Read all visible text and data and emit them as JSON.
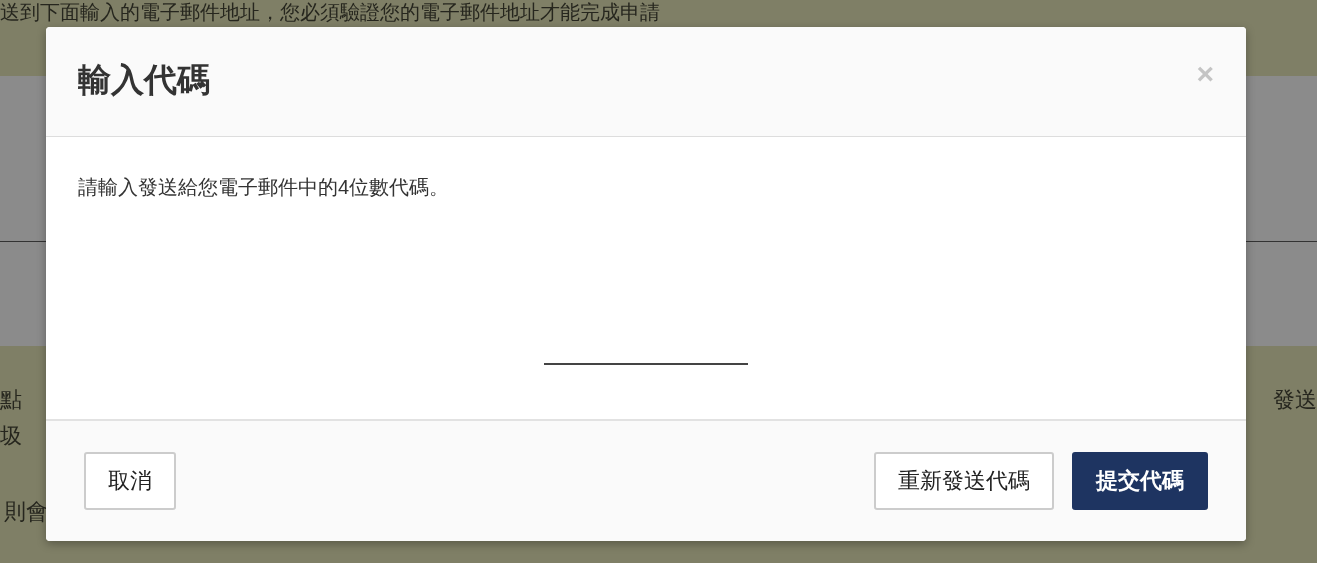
{
  "background_page": {
    "top_text": "送到下面輸入的電子郵件地址，您必須驗證您的電子郵件地址才能完成申請",
    "left_lines": [
      "點",
      "圾",
      "則會"
    ],
    "right_text": "發送"
  },
  "dialog": {
    "title": "輸入代碼",
    "close": "×",
    "message": "請輸入發送給您電子郵件中的4位數代碼。",
    "buttons": [
      {
        "label": "取消",
        "kind": "secondary"
      },
      {
        "label": "重新發送代碼",
        "kind": "secondary"
      },
      {
        "label": "提交代碼",
        "kind": "primary"
      }
    ]
  }
}
